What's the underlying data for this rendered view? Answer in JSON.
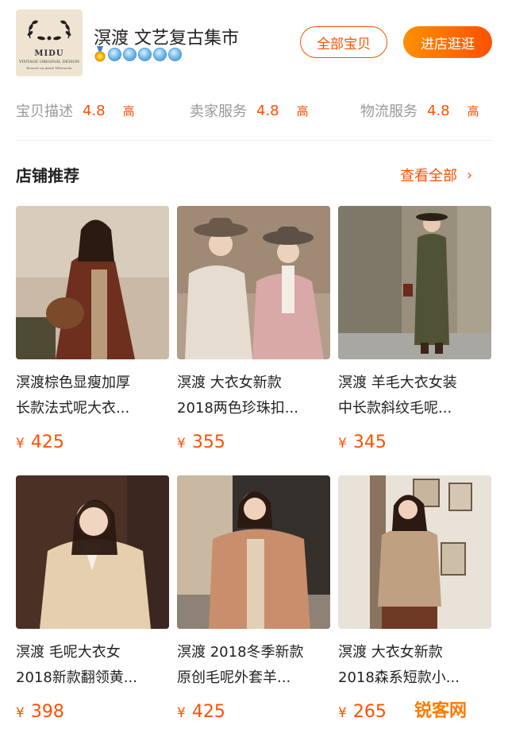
{
  "shop": {
    "logo_brand": "MIDU",
    "logo_sub": "VINTAGE ORIGINAL DESIGN",
    "logo_sub2": "Revenir au passé Vêtements",
    "name": "溟渡 文艺复古集市",
    "badge_icons": [
      "gold-medal-icon",
      "blue-diamond-icon",
      "blue-diamond-icon",
      "blue-diamond-icon",
      "blue-diamond-icon",
      "blue-diamond-icon"
    ],
    "all_items_label": "全部宝贝",
    "enter_shop_label": "进店逛逛"
  },
  "ratings": [
    {
      "label": "宝贝描述",
      "score": "4.8",
      "level": "高"
    },
    {
      "label": "卖家服务",
      "score": "4.8",
      "level": "高"
    },
    {
      "label": "物流服务",
      "score": "4.8",
      "level": "高"
    }
  ],
  "section": {
    "title": "店铺推荐",
    "view_all": "查看全部",
    "chevron_icon": "chevron-right-icon"
  },
  "products": [
    {
      "line1": "溟渡棕色显瘦加厚",
      "line2": "长款法式呢大衣...",
      "currency": "¥",
      "price": "425"
    },
    {
      "line1": "溟渡 大衣女新款",
      "line2": "2018两色珍珠扣...",
      "currency": "¥",
      "price": "355"
    },
    {
      "line1": "溟渡 羊毛大衣女装",
      "line2": "中长款斜纹毛呢...",
      "currency": "¥",
      "price": "345"
    },
    {
      "line1": "溟渡 毛呢大衣女",
      "line2": "2018新款翻领黄...",
      "currency": "¥",
      "price": "398"
    },
    {
      "line1": "溟渡 2018冬季新款",
      "line2": "原创毛呢外套羊...",
      "currency": "¥",
      "price": "425"
    },
    {
      "line1": "溟渡 大衣女新款",
      "line2": "2018森系短款小...",
      "currency": "¥",
      "price": "265"
    }
  ],
  "watermark": {
    "text": "锐客网"
  },
  "colors": {
    "accent": "#ff5000",
    "accent_gradient_start": "#ff9000",
    "muted_text": "#999999"
  }
}
